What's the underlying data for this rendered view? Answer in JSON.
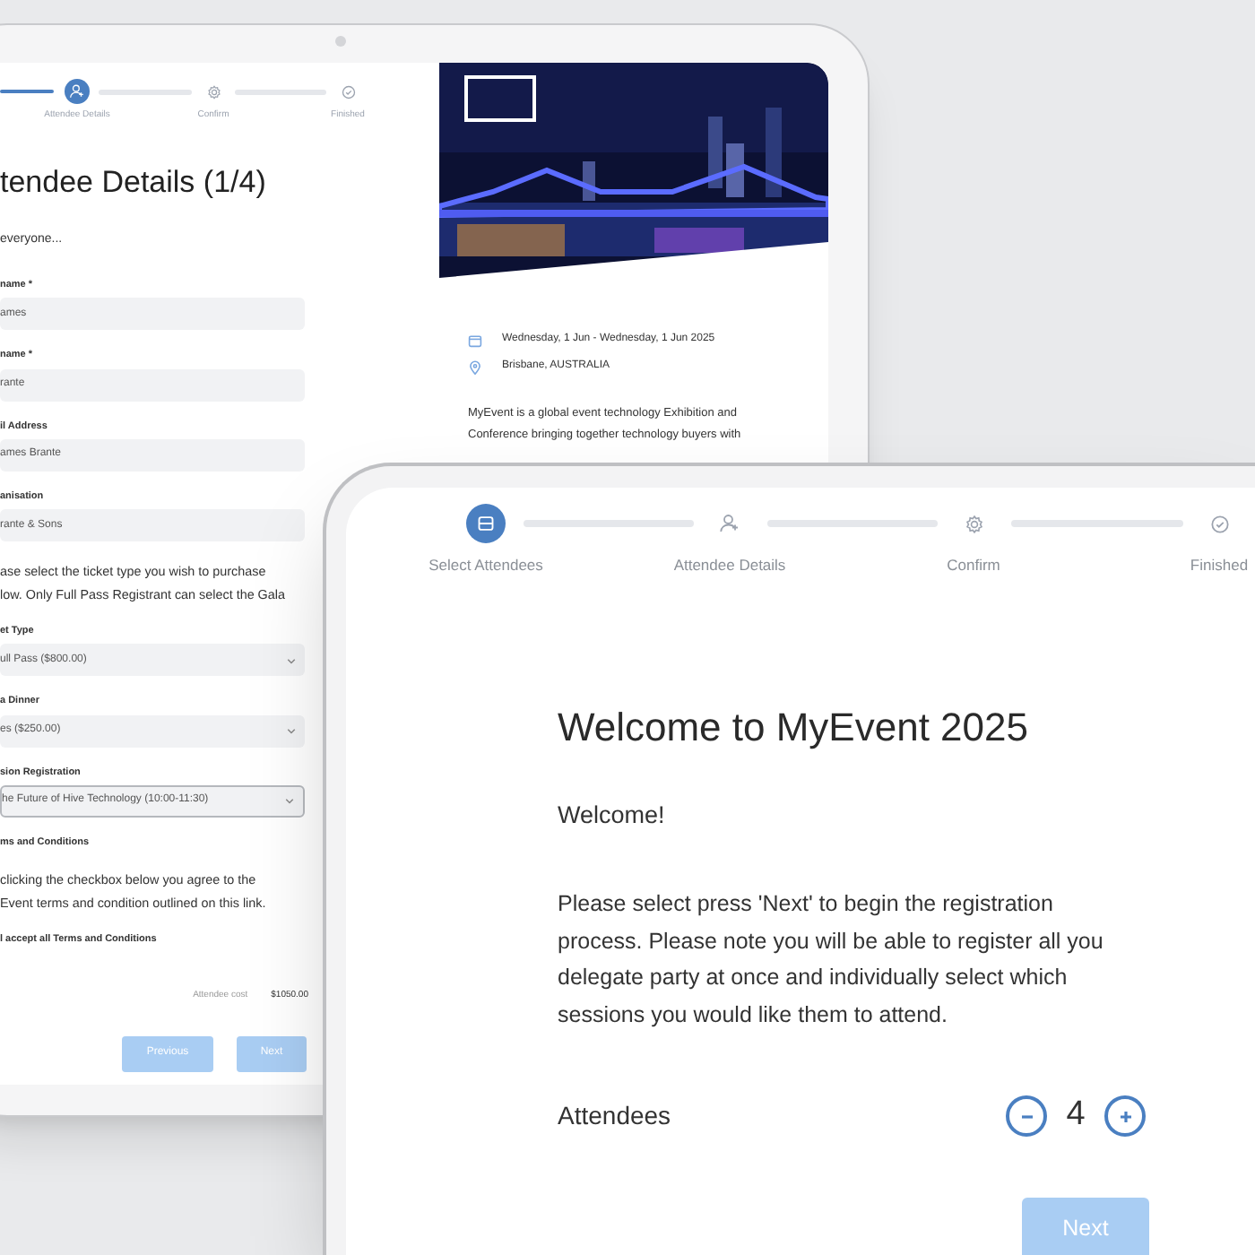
{
  "back_screen": {
    "steps": [
      {
        "label": "Attendee Details",
        "selected": true
      },
      {
        "label": "Confirm",
        "selected": false
      },
      {
        "label": "Finished",
        "selected": false
      }
    ],
    "title": "tendee Details (1/4)",
    "form": [
      {
        "kind": "text",
        "text": "everyone..."
      },
      {
        "kind": "input",
        "label": "name *",
        "value": "ames"
      },
      {
        "kind": "input",
        "label": "name *",
        "value": "rante"
      },
      {
        "kind": "input",
        "label": "il Address",
        "value": "ames Brante"
      },
      {
        "kind": "input",
        "label": "anisation",
        "value": "rante & Sons"
      },
      {
        "kind": "note",
        "lines": [
          "ase select the ticket type you wish to purchase",
          "low. Only Full Pass Registrant can select the Gala"
        ]
      },
      {
        "kind": "select",
        "label": "et Type",
        "value": "ull Pass ($800.00)",
        "focused": false
      },
      {
        "kind": "select",
        "label": "a Dinner",
        "value": "es ($250.00)",
        "focused": false
      },
      {
        "kind": "select",
        "label": "sion Registration",
        "value": "he Future of Hive Technology (10:00-11:30)",
        "focused": true
      },
      {
        "kind": "heading",
        "text": "ms and Conditions"
      },
      {
        "kind": "note",
        "lines": [
          "clicking the checkbox below you agree to the",
          "Event terms and condition outlined on this link."
        ]
      },
      {
        "kind": "heading",
        "text": "l accept all Terms and Conditions"
      }
    ],
    "cost": {
      "label": "Attendee cost",
      "value": "$1050.00"
    },
    "buttons": [
      {
        "label": "Previous"
      },
      {
        "label": "Next"
      }
    ],
    "event": {
      "banner": {
        "kind": "picture"
      },
      "date": "Wednesday, 1 Jun - Wednesday, 1 Jun 2025",
      "location": "Brisbane, AUSTRALIA",
      "description_lines": [
        "MyEvent is a global event technology Exhibition and",
        "Conference bringing together technology buyers with"
      ]
    }
  },
  "front_screen": {
    "steps": [
      {
        "label": "Select Attendees",
        "selected": true
      },
      {
        "label": "Attendee Details",
        "selected": false
      },
      {
        "label": "Confirm",
        "selected": false
      },
      {
        "label": "Finished",
        "selected": false
      }
    ],
    "title": "Welcome to MyEvent 2025",
    "greeting": "Welcome!",
    "message_lines": [
      "Please select press 'Next' to begin the registration",
      "process. Please note you will be able to register all you",
      "delegate party at once and individually select which",
      "sessions you would like them to attend."
    ],
    "attendees": {
      "label": "Attendees",
      "count": "4"
    },
    "next_button": "Next"
  }
}
